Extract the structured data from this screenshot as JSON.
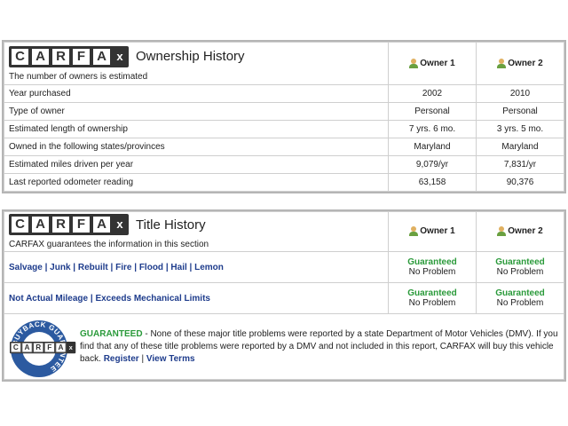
{
  "ownership": {
    "logo": "CARFAX",
    "title": "Ownership History",
    "subtitle": "The number of owners is estimated",
    "owners": [
      "Owner 1",
      "Owner 2"
    ],
    "rows": [
      {
        "label": "Year purchased",
        "values": [
          "2002",
          "2010"
        ]
      },
      {
        "label": "Type of owner",
        "values": [
          "Personal",
          "Personal"
        ]
      },
      {
        "label": "Estimated length of ownership",
        "values": [
          "7 yrs. 6 mo.",
          "3 yrs. 5 mo."
        ]
      },
      {
        "label": "Owned in the following states/provinces",
        "values": [
          "Maryland",
          "Maryland"
        ]
      },
      {
        "label": "Estimated miles driven per year",
        "values": [
          "9,079/yr",
          "7,831/yr"
        ]
      },
      {
        "label": "Last reported odometer reading",
        "values": [
          "63,158",
          "90,376"
        ]
      }
    ]
  },
  "title_history": {
    "logo": "CARFAX",
    "title": "Title History",
    "subtitle": "CARFAX guarantees the information in this section",
    "owners": [
      "Owner 1",
      "Owner 2"
    ],
    "rows": [
      {
        "links": [
          "Salvage",
          "Junk",
          "Rebuilt",
          "Fire",
          "Flood",
          "Hail",
          "Lemon"
        ],
        "status": [
          "Guaranteed",
          "Guaranteed"
        ],
        "result": [
          "No Problem",
          "No Problem"
        ]
      },
      {
        "links": [
          "Not Actual Mileage",
          "Exceeds Mechanical Limits"
        ],
        "status": [
          "Guaranteed",
          "Guaranteed"
        ],
        "result": [
          "No Problem",
          "No Problem"
        ]
      }
    ],
    "guarantee": {
      "badge": "BUYBACK GUARANTEE",
      "heading": "GUARANTEED",
      "text": " - None of these major title problems were reported by a state Department of Motor Vehicles (DMV). If you find that any of these title problems were reported by a DMV and not included in this report, CARFAX will buy this vehicle back. ",
      "register": "Register",
      "view_terms": "View Terms"
    }
  },
  "colors": {
    "link": "#1e3c8c",
    "guaranteed": "#2a9a3a",
    "border": "#b5b5b5"
  }
}
